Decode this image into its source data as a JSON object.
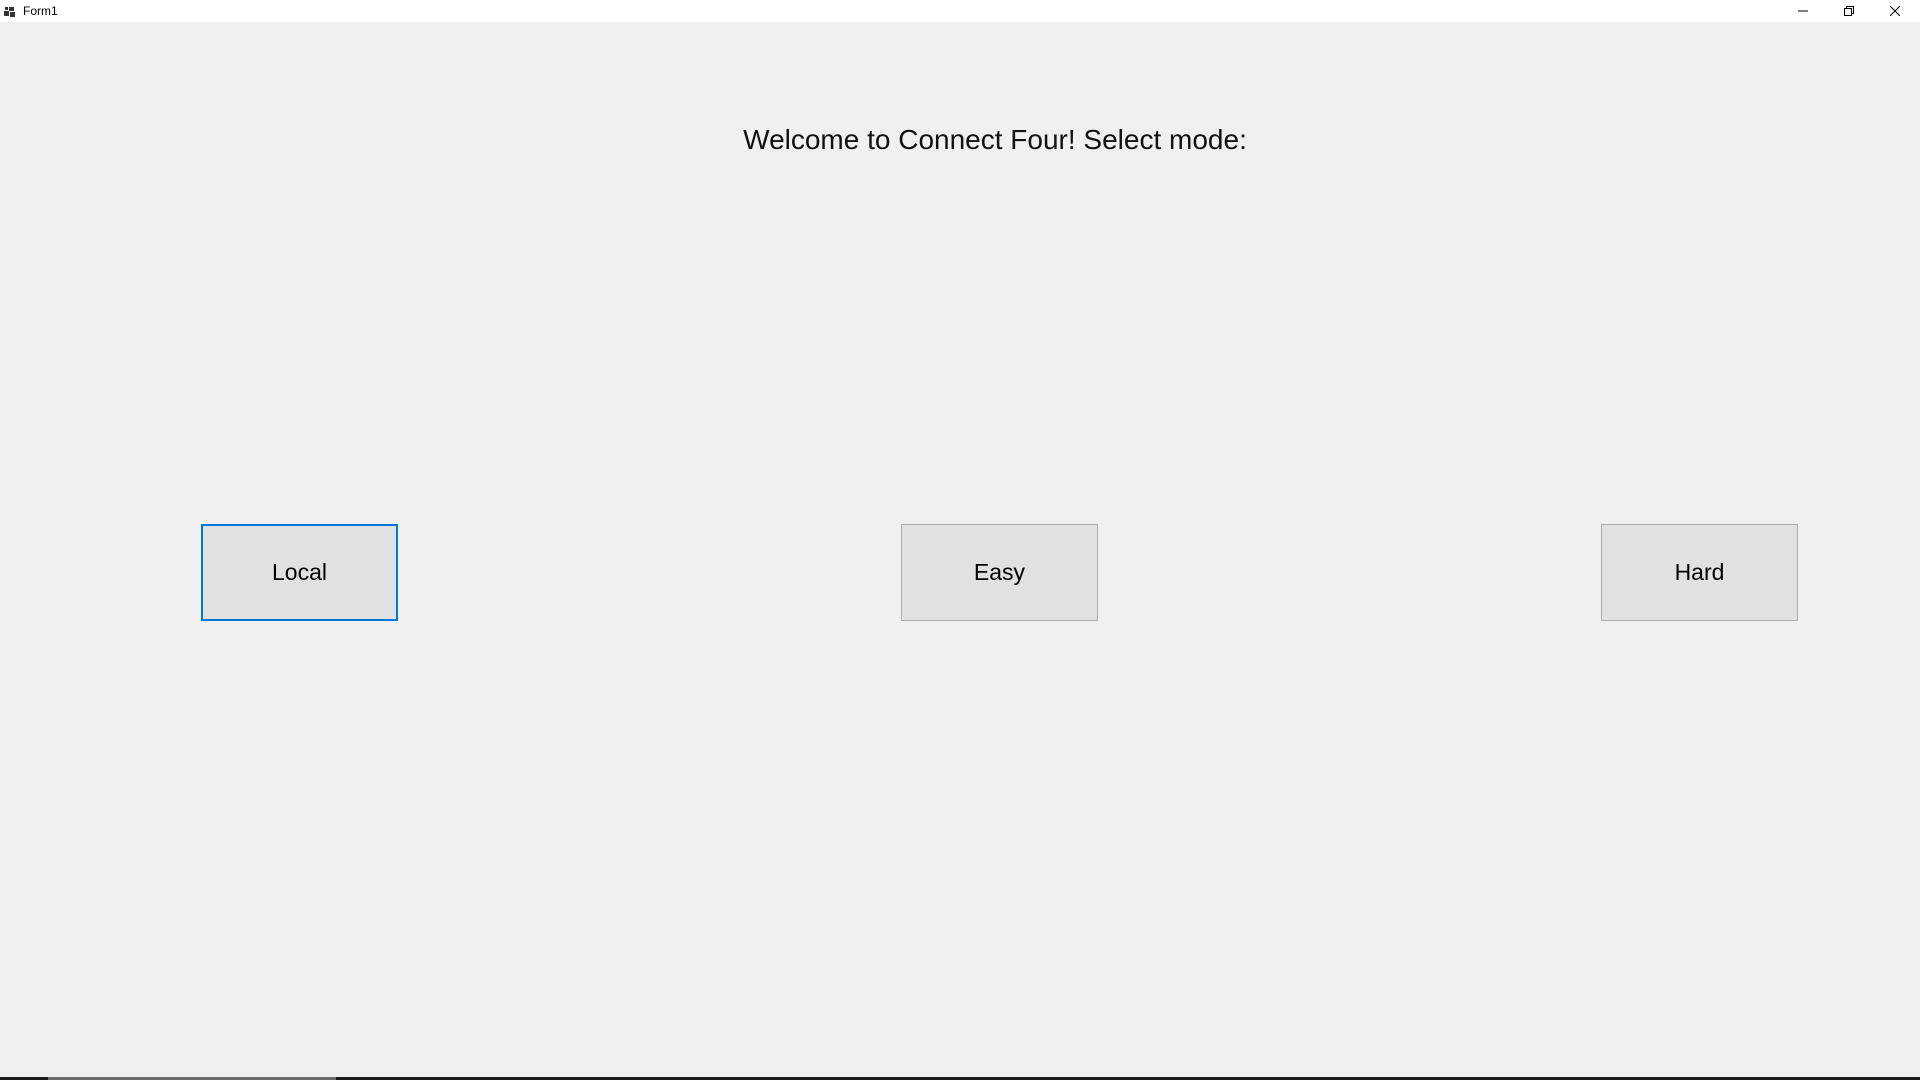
{
  "window": {
    "title": "Form1",
    "icons": {
      "app": "app-form-icon",
      "minimize": "minimize-icon",
      "maximize": "restore-icon",
      "close": "close-icon"
    }
  },
  "main": {
    "welcome_text": "Welcome to Connect Four! Select mode:",
    "buttons": [
      {
        "label": "Local",
        "focused": true
      },
      {
        "label": "Easy",
        "focused": false
      },
      {
        "label": "Hard",
        "focused": false
      }
    ]
  },
  "colors": {
    "background": "#f0f0f0",
    "button_face": "#e1e1e1",
    "button_border": "#adadad",
    "focus_border": "#0078d7"
  }
}
